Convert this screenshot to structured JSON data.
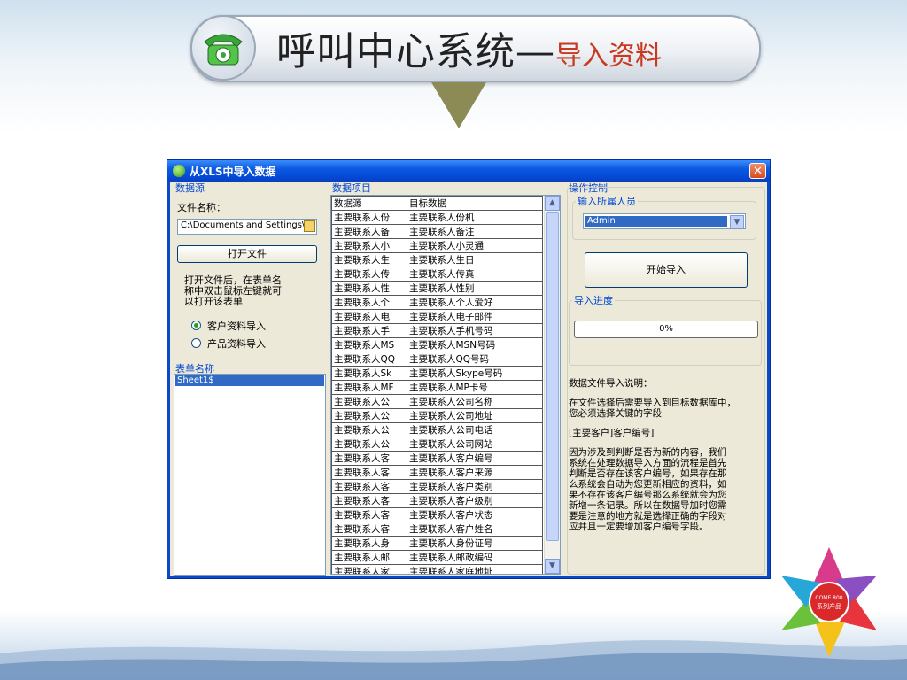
{
  "header": {
    "title": "呼叫中心系统—",
    "subtitle": "导入资料",
    "icon": "telephone-icon"
  },
  "dialog": {
    "title": "从XLS中导入数据",
    "close_label": "✕",
    "datasource": {
      "group_label": "数据源",
      "file_label": "文件名称：",
      "file_value": "C:\\Documents and Settings\\",
      "open_button": "打开文件",
      "help_text": [
        "打开文件后，在表单名",
        "称中双击鼠标左键就可",
        "以打开该表单"
      ],
      "radio_customer": "客户资料导入",
      "radio_product": "产品资料导入",
      "selected_radio": "customer",
      "sheet_group_label": "表单名称",
      "sheets": [
        "Sheet1$"
      ]
    },
    "data_items": {
      "group_label": "数据项目",
      "columns": [
        "数据源",
        "目标数据"
      ],
      "rows": [
        [
          "主要联系人份",
          "主要联系人份机"
        ],
        [
          "主要联系人备",
          "主要联系人备注"
        ],
        [
          "主要联系人小",
          "主要联系人小灵通"
        ],
        [
          "主要联系人生",
          "主要联系人生日"
        ],
        [
          "主要联系人传",
          "主要联系人传真"
        ],
        [
          "主要联系人性",
          "主要联系人性别"
        ],
        [
          "主要联系人个",
          "主要联系人个人爱好"
        ],
        [
          "主要联系人电",
          "主要联系人电子邮件"
        ],
        [
          "主要联系人手",
          "主要联系人手机号码"
        ],
        [
          "主要联系人MS",
          "主要联系人MSN号码"
        ],
        [
          "主要联系人QQ",
          "主要联系人QQ号码"
        ],
        [
          "主要联系人Sk",
          "主要联系人Skype号码"
        ],
        [
          "主要联系人MF",
          "主要联系人MP卡号"
        ],
        [
          "主要联系人公",
          "主要联系人公司名称"
        ],
        [
          "主要联系人公",
          "主要联系人公司地址"
        ],
        [
          "主要联系人公",
          "主要联系人公司电话"
        ],
        [
          "主要联系人公",
          "主要联系人公司网站"
        ],
        [
          "主要联系人客",
          "主要联系人客户编号"
        ],
        [
          "主要联系人客",
          "主要联系人客户来源"
        ],
        [
          "主要联系人客",
          "主要联系人客户类别"
        ],
        [
          "主要联系人客",
          "主要联系人客户级别"
        ],
        [
          "主要联系人客",
          "主要联系人客户状态"
        ],
        [
          "主要联系人客",
          "主要联系人客户姓名"
        ],
        [
          "主要联系人身",
          "主要联系人身份证号"
        ],
        [
          "主要联系人邮",
          "主要联系人邮政编码"
        ],
        [
          "主要联系人家",
          "主要联系人家庭地址"
        ]
      ]
    },
    "control": {
      "group_label": "操作控制",
      "user_group_label": "输入所属人员",
      "user_value": "Admin",
      "start_button": "开始导入",
      "progress_group_label": "导入进度",
      "progress_text": "0%",
      "progress_value": 0,
      "notes_title": "数据文件导入说明：",
      "notes_p1": [
        "在文件选择后需要导入到目标数据库中，",
        "您必须选择关键的字段"
      ],
      "notes_key": "[主要客户]客户编号]",
      "notes_p2": [
        "因为涉及到判断是否为新的内容，我们",
        "系统在处理数据导入方面的流程是首先",
        "判断是否存在该客户编号，如果存在那",
        "么系统会自动为您更新相应的资料，如",
        "果不存在该客户编号那么系统就会为您",
        "新增一条记录。所以在数据导加时您需",
        "要是注意的地方就是选择正确的字段对",
        "应并且一定要增加客户编号字段。"
      ]
    }
  },
  "logo": {
    "center_top": "COME 800",
    "center_bottom": "系列产品"
  },
  "colors": {
    "titlebar": "#0449d6",
    "group_label": "#0046d5",
    "selection": "#316ac5",
    "subtitle": "#c8391f",
    "arrow": "#8c8a55"
  }
}
